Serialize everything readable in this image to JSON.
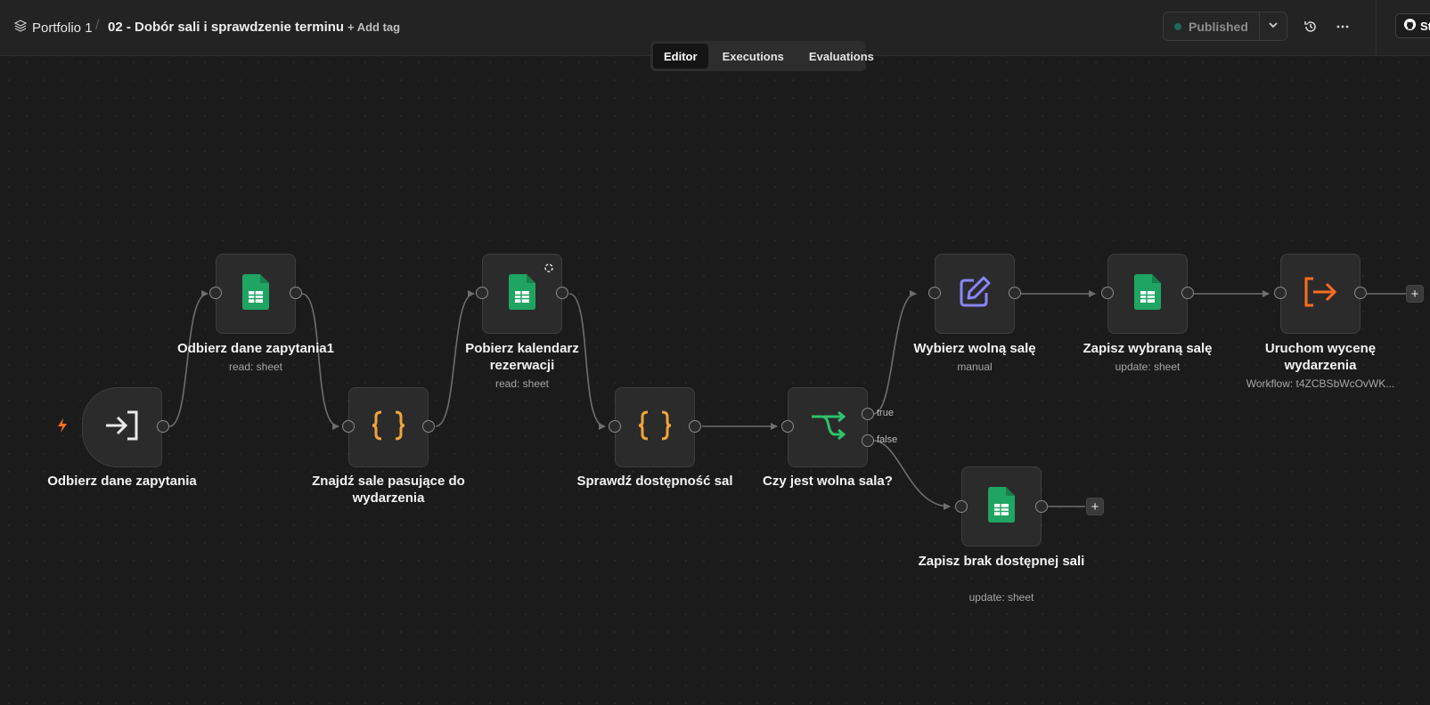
{
  "header": {
    "project": "Portfolio 1",
    "separator": "/",
    "workflow_name": "02 - Dobór sali i sprawdzenie terminu",
    "add_tag": "+ Add tag",
    "publish_status": "Published",
    "github_label": "St"
  },
  "tabs": [
    "Editor",
    "Executions",
    "Evaluations"
  ],
  "nodes": {
    "trigger": {
      "label": "Odbierz dane zapytania",
      "icon": "sign-in-icon"
    },
    "read1": {
      "label": "Odbierz dane zapytania1",
      "sub": "read: sheet",
      "icon": "google-sheets-icon"
    },
    "code1": {
      "label": "Znajdź sale pasujące do wydarzenia",
      "icon": "curly-braces-icon"
    },
    "read2": {
      "label": "Pobierz kalendarz rezerwacji",
      "sub": "read: sheet",
      "icon": "google-sheets-icon"
    },
    "code2": {
      "label": "Sprawdź dostępność sal",
      "icon": "curly-braces-icon"
    },
    "if": {
      "label": "Czy jest wolna sala?",
      "icon": "if-branch-icon",
      "true_label": "true",
      "false_label": "false"
    },
    "set": {
      "label": "Wybierz wolną salę",
      "sub": "manual",
      "icon": "edit-icon"
    },
    "update1": {
      "label": "Zapisz wybraną salę",
      "sub": "update: sheet",
      "icon": "google-sheets-icon"
    },
    "exec": {
      "label": "Uruchom wycenę wydarzenia",
      "sub": "Workflow: t4ZCBSbWcOvWK...",
      "icon": "execute-workflow-icon"
    },
    "update2": {
      "label": "Zapisz brak dostępnej sali",
      "sub": "update: sheet",
      "icon": "google-sheets-icon"
    }
  },
  "colors": {
    "sheets_green": "#1fa463",
    "code_orange": "#f2a33a",
    "if_green": "#2ec26b",
    "edit_purple": "#8b84ff",
    "exec_orange": "#ff6d1f",
    "trigger_bolt": "#ff6d1f"
  }
}
